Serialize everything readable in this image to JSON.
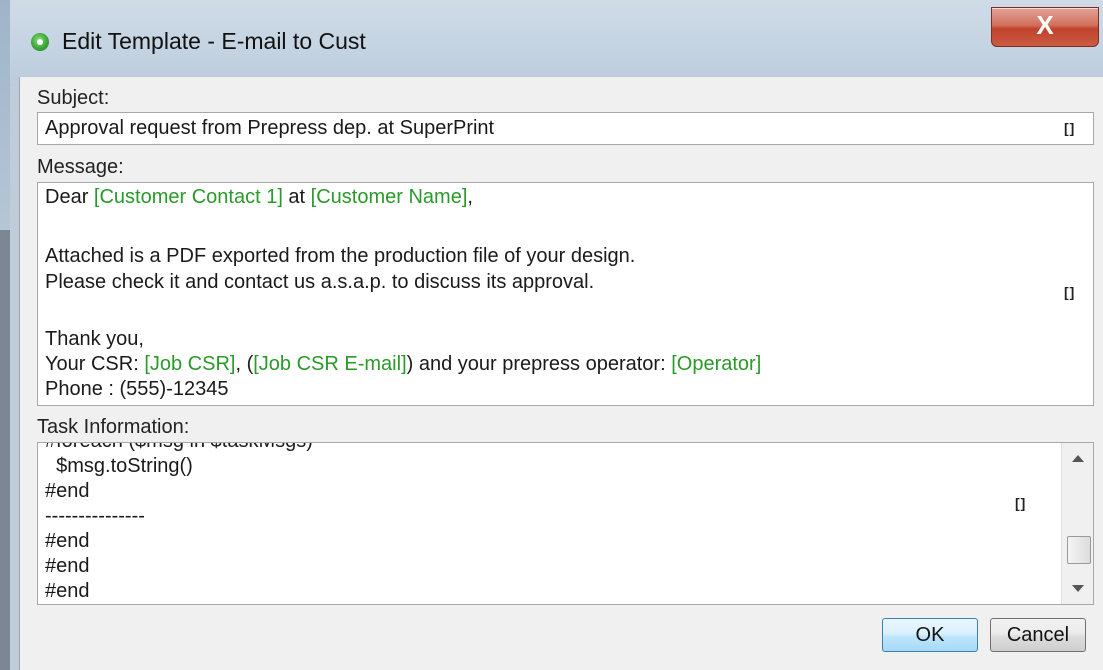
{
  "window": {
    "title": "Edit Template - E-mail to Cust",
    "close_label": "X"
  },
  "subject": {
    "label": "Subject:",
    "value": "Approval request from Prepress dep. at SuperPrint",
    "expand_label": "[]"
  },
  "message": {
    "label": "Message:",
    "expand_label": "[]",
    "line1": {
      "t1": "Dear ",
      "v1": "[Customer Contact 1]",
      "t2": " at ",
      "v2": "[Customer Name]",
      "t3": ","
    },
    "line2": "Attached is a PDF exported from the production file of your design.",
    "line3": "Please check it and contact us a.s.a.p. to discuss its approval.",
    "line4": "Thank you,",
    "line5": {
      "t1": "Your CSR: ",
      "v1": "[Job CSR]",
      "t2": ", (",
      "v2": "[Job CSR E-mail]",
      "t3": ") and your prepress operator: ",
      "v3": "[Operator]"
    },
    "line6": "Phone : (555)-12345"
  },
  "task_info": {
    "label": "Task Information:",
    "expand_label": "[]",
    "lines": [
      "#foreach ($msg in $taskMsgs)",
      "  $msg.toString()",
      "#end",
      "---------------",
      "#end",
      "#end",
      "#end"
    ]
  },
  "buttons": {
    "ok": "OK",
    "cancel": "Cancel"
  },
  "colors": {
    "variable": "#2a9a2a",
    "ok_border": "#3c7fb1",
    "close": "#c0422a"
  }
}
